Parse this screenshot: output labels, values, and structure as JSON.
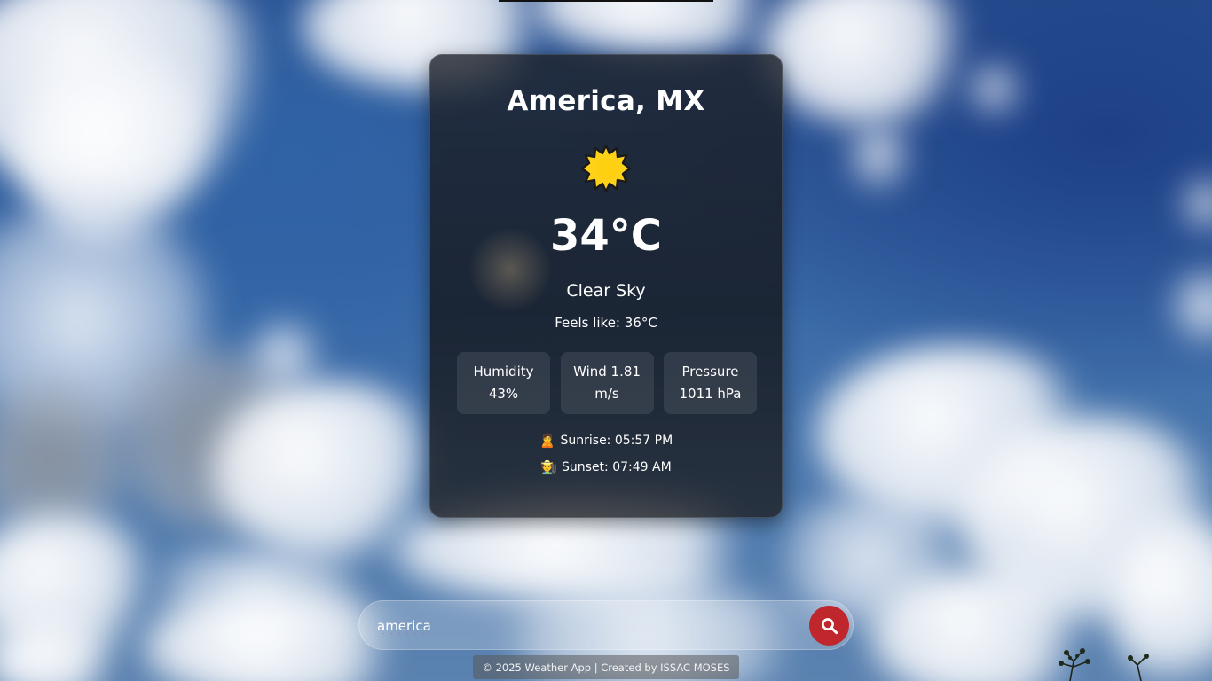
{
  "weather": {
    "city": "America, MX",
    "temperature": "34°C",
    "condition": "Clear Sky",
    "feels_like": "Feels like: 36°C",
    "icon": "sun-icon",
    "stats": {
      "humidity_label": "Humidity",
      "humidity_value": "43%",
      "wind_label": "Wind 1.81",
      "wind_value": "m/s",
      "pressure_label": "Pressure",
      "pressure_value": "1011 hPa"
    },
    "sunrise": "Sunrise: 05:57 PM",
    "sunset": "Sunset: 07:49 AM",
    "sunrise_emoji": "🙎",
    "sunset_emoji": "🧑‍🌾"
  },
  "search": {
    "value": "america",
    "icon": "search-icon"
  },
  "footer": {
    "text": "© 2025 Weather App | Created by ISSAC MOSES"
  },
  "colors": {
    "accent_button": "#c0272d",
    "card_bg": "#1c2029",
    "sun": "#ffd21a"
  }
}
